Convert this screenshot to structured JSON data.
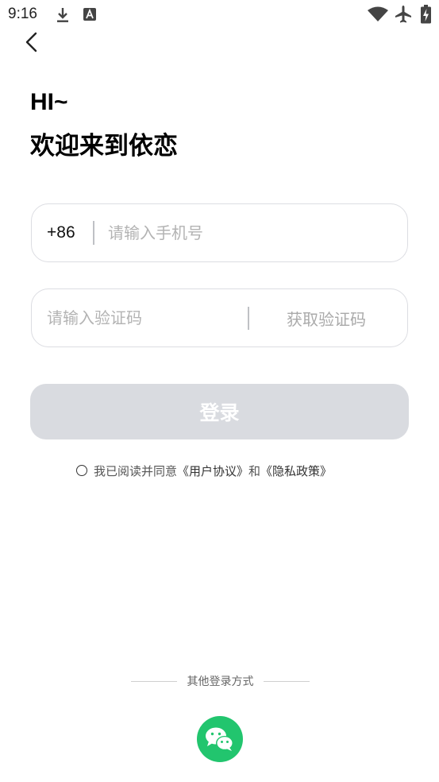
{
  "status_bar": {
    "time": "9:16",
    "icons": [
      "download-icon",
      "app-notification-icon",
      "wifi-icon",
      "airplane-icon",
      "battery-charging-icon"
    ]
  },
  "header": {
    "back_icon": "chevron-left-icon"
  },
  "greeting": {
    "line1": "HI~",
    "line2": "欢迎来到依恋"
  },
  "phone_field": {
    "country_code": "+86",
    "placeholder": "请输入手机号",
    "value": ""
  },
  "code_field": {
    "placeholder": "请输入验证码",
    "value": "",
    "get_code_label": "获取验证码"
  },
  "login_button": {
    "label": "登录",
    "enabled": false
  },
  "agreement": {
    "checked": false,
    "prefix": "我已阅读并同意",
    "user_agreement": "《用户协议》",
    "conjunction": "和",
    "privacy_policy": "《隐私政策》"
  },
  "other_login": {
    "label": "其他登录方式",
    "wechat_icon": "wechat-icon"
  },
  "colors": {
    "login_disabled_bg": "#d9dbe0",
    "wechat_green": "#22c56e",
    "field_border": "#dcdde2",
    "placeholder": "#b3b3b3"
  }
}
